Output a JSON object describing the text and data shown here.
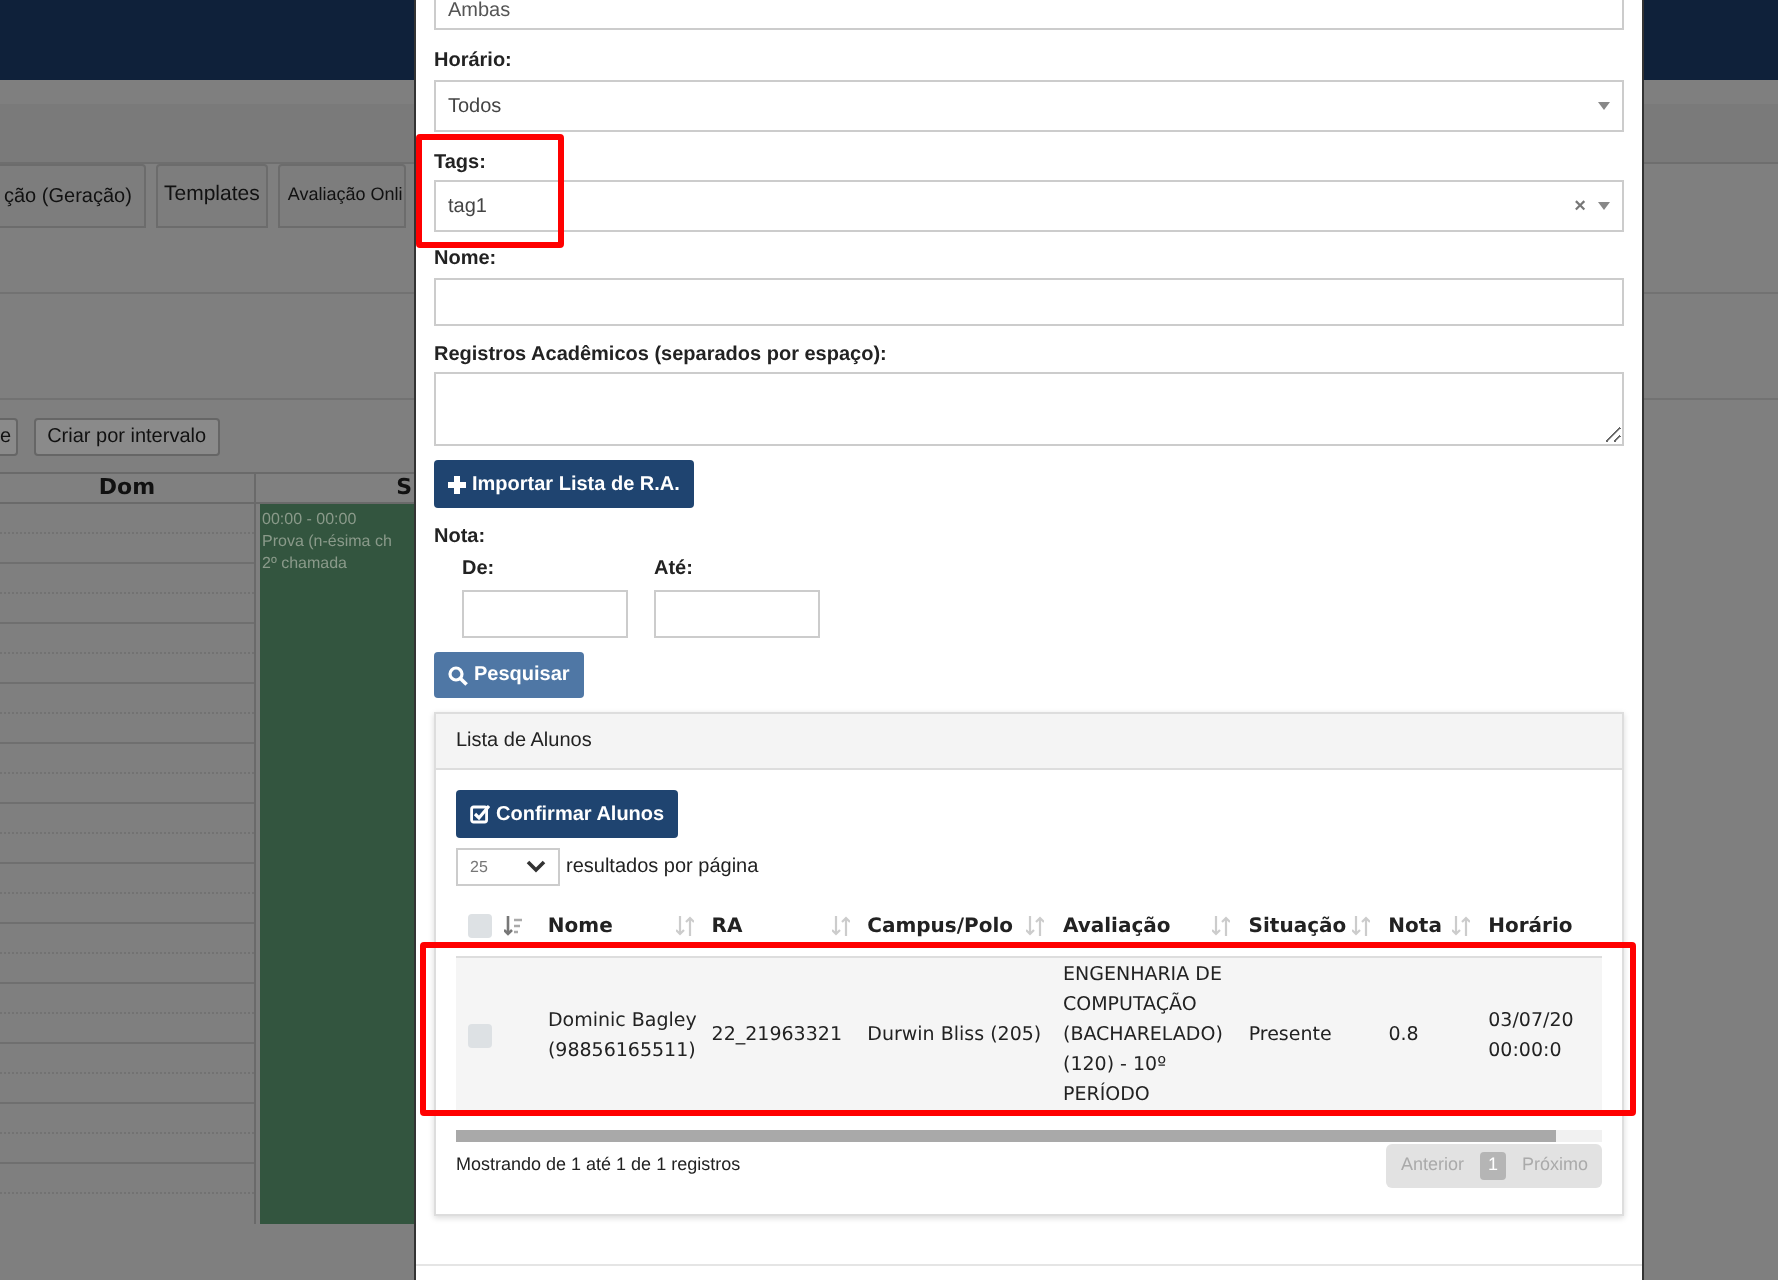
{
  "background": {
    "tabs": [
      "ção (Geração)",
      "Templates",
      "Avaliação Onli"
    ],
    "buttons": [
      "e",
      "Criar por intervalo"
    ],
    "calendar": {
      "columns": [
        "Dom",
        "S"
      ],
      "event": [
        "00:00 - 00:00",
        "Prova (n-ésima ch",
        "2º chamada"
      ]
    }
  },
  "modal": {
    "top_field": {
      "value": "Ambas"
    },
    "horario": {
      "label": "Horário:",
      "value": "Todos"
    },
    "tags": {
      "label": "Tags:",
      "value": "tag1",
      "clear": "×"
    },
    "nome": {
      "label": "Nome:"
    },
    "registros": {
      "label": "Registros Acadêmicos (separados por espaço):"
    },
    "import_button": "Importar Lista de R.A.",
    "nota": {
      "label": "Nota:",
      "from_label": "De:",
      "to_label": "Até:"
    },
    "search_button": "Pesquisar",
    "panel": {
      "title": "Lista de Alunos",
      "confirm_button": "Confirmar Alunos",
      "page_size": "25",
      "page_size_label": "resultados por página",
      "table": {
        "header_checkbox": {
          "checked": false
        },
        "columns": [
          "Nome",
          "RA",
          "Campus/Polo",
          "Avaliação",
          "Situação",
          "Nota",
          "Horário"
        ],
        "rows": [
          {
            "checked": false,
            "cells": [
              "Dominic Bagley (98856165511)",
              "22_21963321",
              "Durwin Bliss (205)",
              "ENGENHARIA DE COMPUTAÇÃO (BACHARELADO) (120) - 10º PERÍODO",
              "Presente",
              "0.8",
              "03/07/20 00:00:0"
            ]
          }
        ]
      },
      "info": "Mostrando de 1 até 1 de 1 registros",
      "pagination": [
        {
          "label": "Anterior",
          "disabled": true,
          "selected": false
        },
        {
          "label": "1",
          "disabled": false,
          "selected": true
        },
        {
          "label": "Próximo",
          "disabled": true,
          "selected": false
        }
      ]
    }
  }
}
